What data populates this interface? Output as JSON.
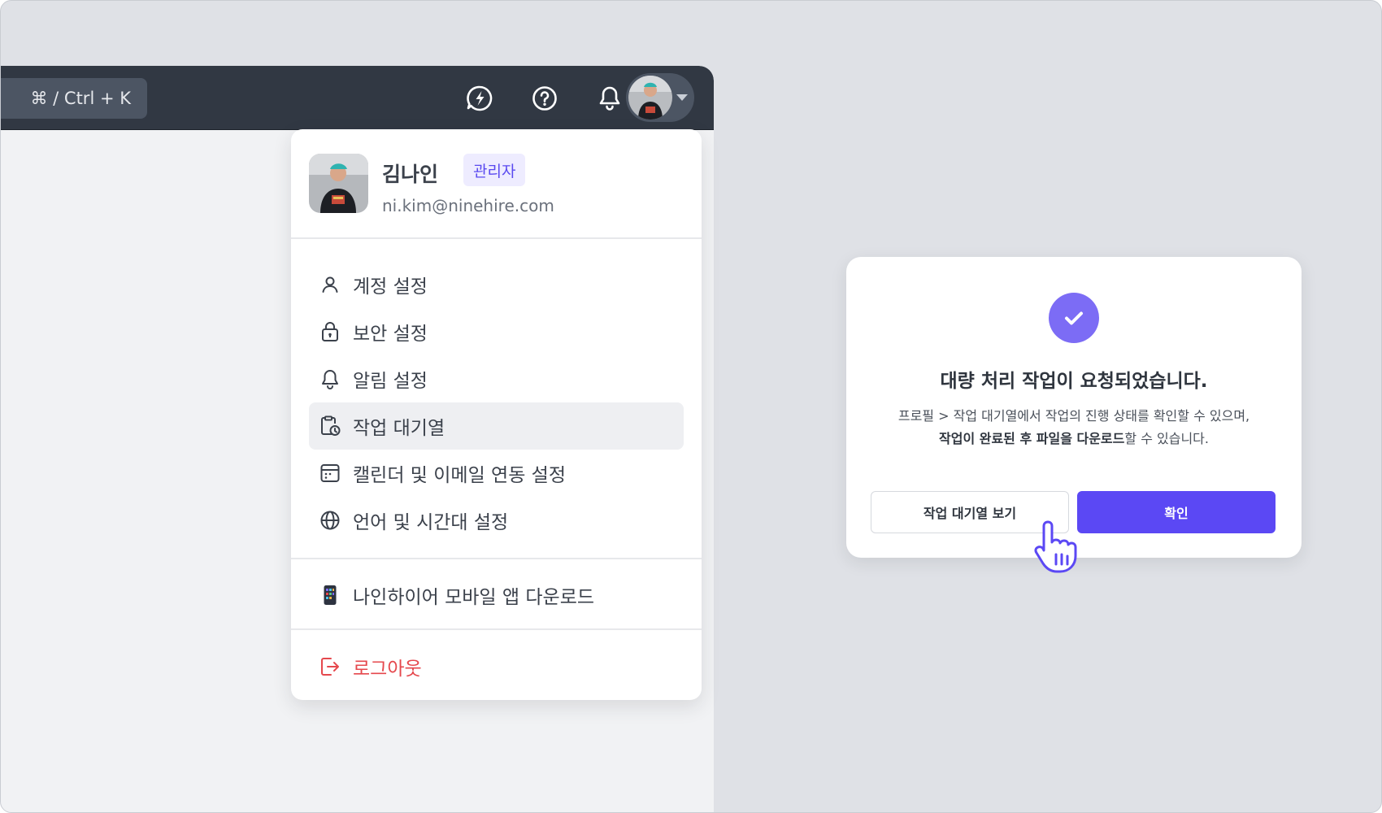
{
  "colors": {
    "background": "#dfe1e6",
    "topbar": "#313843",
    "accent": "#5b48f4",
    "badge_bg": "#eeecff",
    "badge_text": "#5a4af0",
    "logout": "#e5484d"
  },
  "topbar": {
    "search_shortcut": "⌘ / Ctrl + K",
    "icons": [
      "chat-bolt-icon",
      "help-icon",
      "bell-icon"
    ]
  },
  "profile": {
    "name": "김나인",
    "role_badge": "관리자",
    "email": "ni.kim@ninehire.com"
  },
  "menu": {
    "items": [
      {
        "label": "계정 설정",
        "icon": "user-icon"
      },
      {
        "label": "보안 설정",
        "icon": "lock-icon"
      },
      {
        "label": "알림 설정",
        "icon": "bell-icon"
      },
      {
        "label": "작업 대기열",
        "icon": "clipboard-clock-icon",
        "active": true
      },
      {
        "label": "캘린더 및 이메일 연동 설정",
        "icon": "calendar-icon"
      },
      {
        "label": "언어 및 시간대 설정",
        "icon": "globe-icon"
      }
    ],
    "app_download": "나인하이어 모바일 앱 다운로드",
    "logout": "로그아웃"
  },
  "dialog": {
    "title": "대량 처리 작업이 요청되었습니다.",
    "desc_line1": "프로필 > 작업 대기열에서 작업의 진행 상태를 확인할 수 있으며,",
    "desc_bold": "작업이 완료된 후 파일을 다운로드",
    "desc_tail": "할 수 있습니다.",
    "secondary_button": "작업 대기열 보기",
    "primary_button": "확인"
  }
}
